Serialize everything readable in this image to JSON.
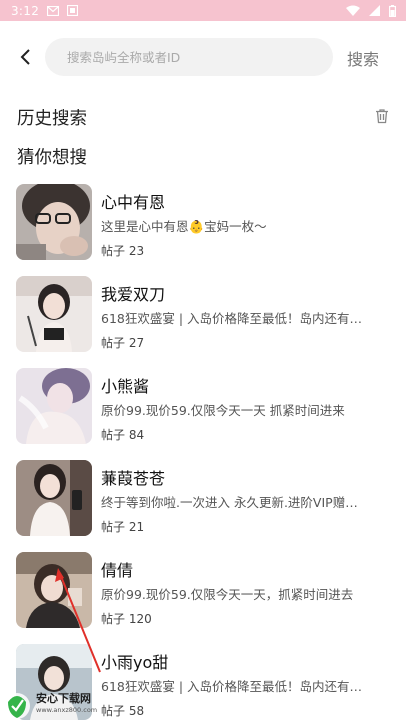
{
  "status_bar": {
    "time": "3:12"
  },
  "search": {
    "placeholder": "搜索岛屿全称或者ID",
    "button_label": "搜索"
  },
  "history": {
    "title": "历史搜索"
  },
  "suggest": {
    "title": "猜你想搜"
  },
  "items": [
    {
      "name": "心中有恩",
      "desc": "这里是心中有恩👶宝妈一枚～",
      "posts": "帖子 23"
    },
    {
      "name": "我爱双刀",
      "desc": "618狂欢盛宴 | 入岛价格降至最低！岛内还有…",
      "posts": "帖子 27"
    },
    {
      "name": "小熊酱",
      "desc": "原价99.现价59.仅限今天一天 抓紧时间进来",
      "posts": "帖子 84"
    },
    {
      "name": "蒹葭苍苍",
      "desc": "终于等到你啦.一次进入 永久更新.进阶VIP赠…",
      "posts": "帖子 21"
    },
    {
      "name": "倩倩",
      "desc": "原价99.现价59.仅限今天一天，抓紧时间进去",
      "posts": "帖子 120"
    },
    {
      "name": "小雨yo甜",
      "desc": "618狂欢盛宴 | 入岛价格降至最低！岛内还有…",
      "posts": "帖子 58"
    }
  ],
  "watermark": {
    "text": "安心下载网",
    "url": "www.anxz800.com"
  }
}
